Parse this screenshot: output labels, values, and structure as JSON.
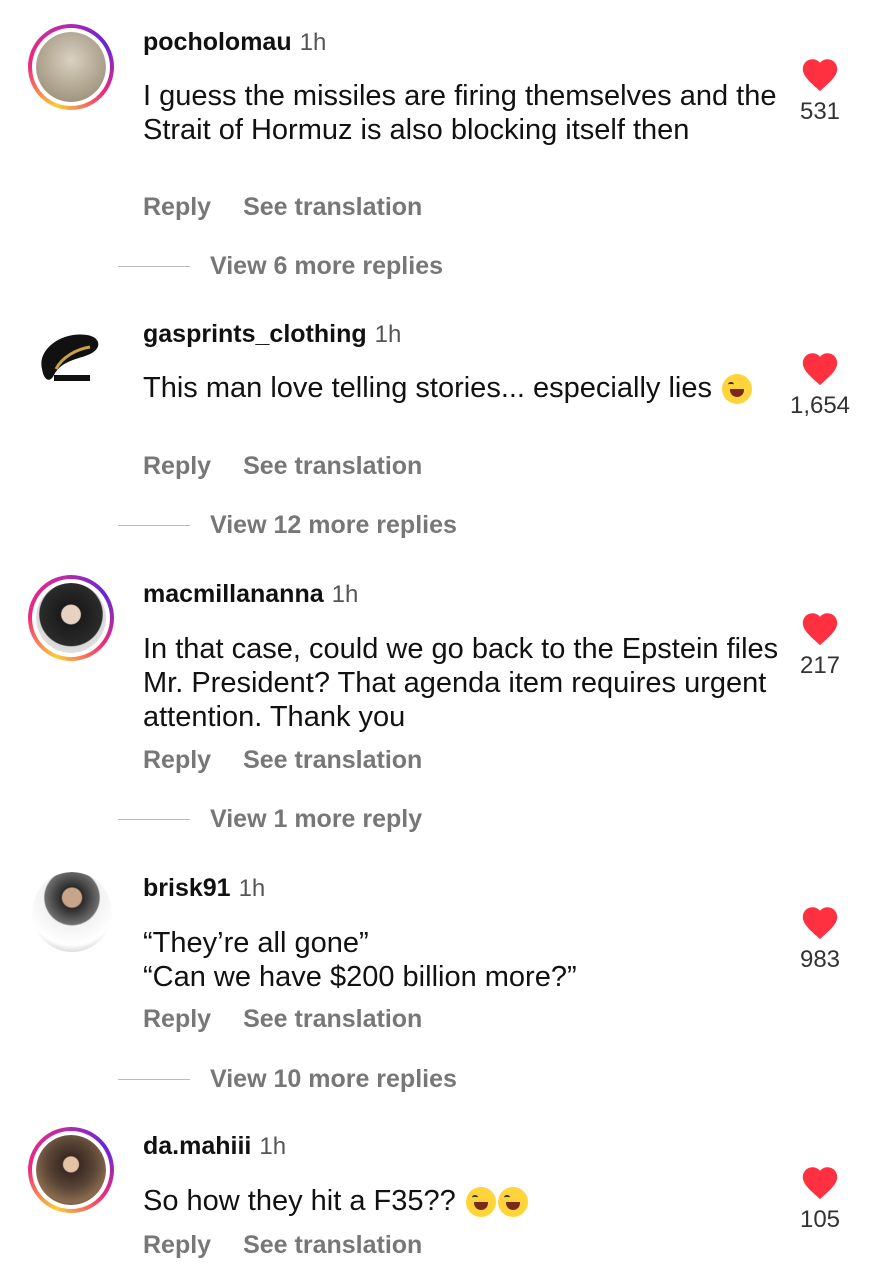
{
  "comments": [
    {
      "username": "pocholomau",
      "time": "1h",
      "text": "I guess the missiles are firing themselves and the Strait of Hormuz is also blocking itself then",
      "likes": "531",
      "reply": "Reply",
      "see_translation": "See translation",
      "more_replies": "View 6 more replies"
    },
    {
      "username": "gasprints_clothing",
      "time": "1h",
      "text": "This man love telling stories... especially lies",
      "likes": "1,654",
      "reply": "Reply",
      "see_translation": "See translation",
      "more_replies": "View 12 more replies"
    },
    {
      "username": "macmillananna",
      "time": "1h",
      "text": "In that case, could we go back to the Epstein files Mr. President? That agenda item requires urgent attention. Thank you",
      "likes": "217",
      "reply": "Reply",
      "see_translation": "See translation",
      "more_replies": "View 1 more reply"
    },
    {
      "username": "brisk91",
      "time": "1h",
      "text_line1": "“They’re all gone”",
      "text_line2": "“Can we have $200 billion more?”",
      "likes": "983",
      "reply": "Reply",
      "see_translation": "See translation",
      "more_replies": "View 10 more replies"
    },
    {
      "username": "da.mahiii",
      "time": "1h",
      "text": "So how they hit a F35??",
      "likes": "105",
      "reply": "Reply",
      "see_translation": "See translation"
    }
  ],
  "colors": {
    "heart": "#ff3040",
    "story_ring_start": "#f9ce34",
    "story_ring_end": "#6228d7"
  },
  "icons": {
    "like": "heart-icon",
    "emoji": "laughing-emoji-icon"
  }
}
